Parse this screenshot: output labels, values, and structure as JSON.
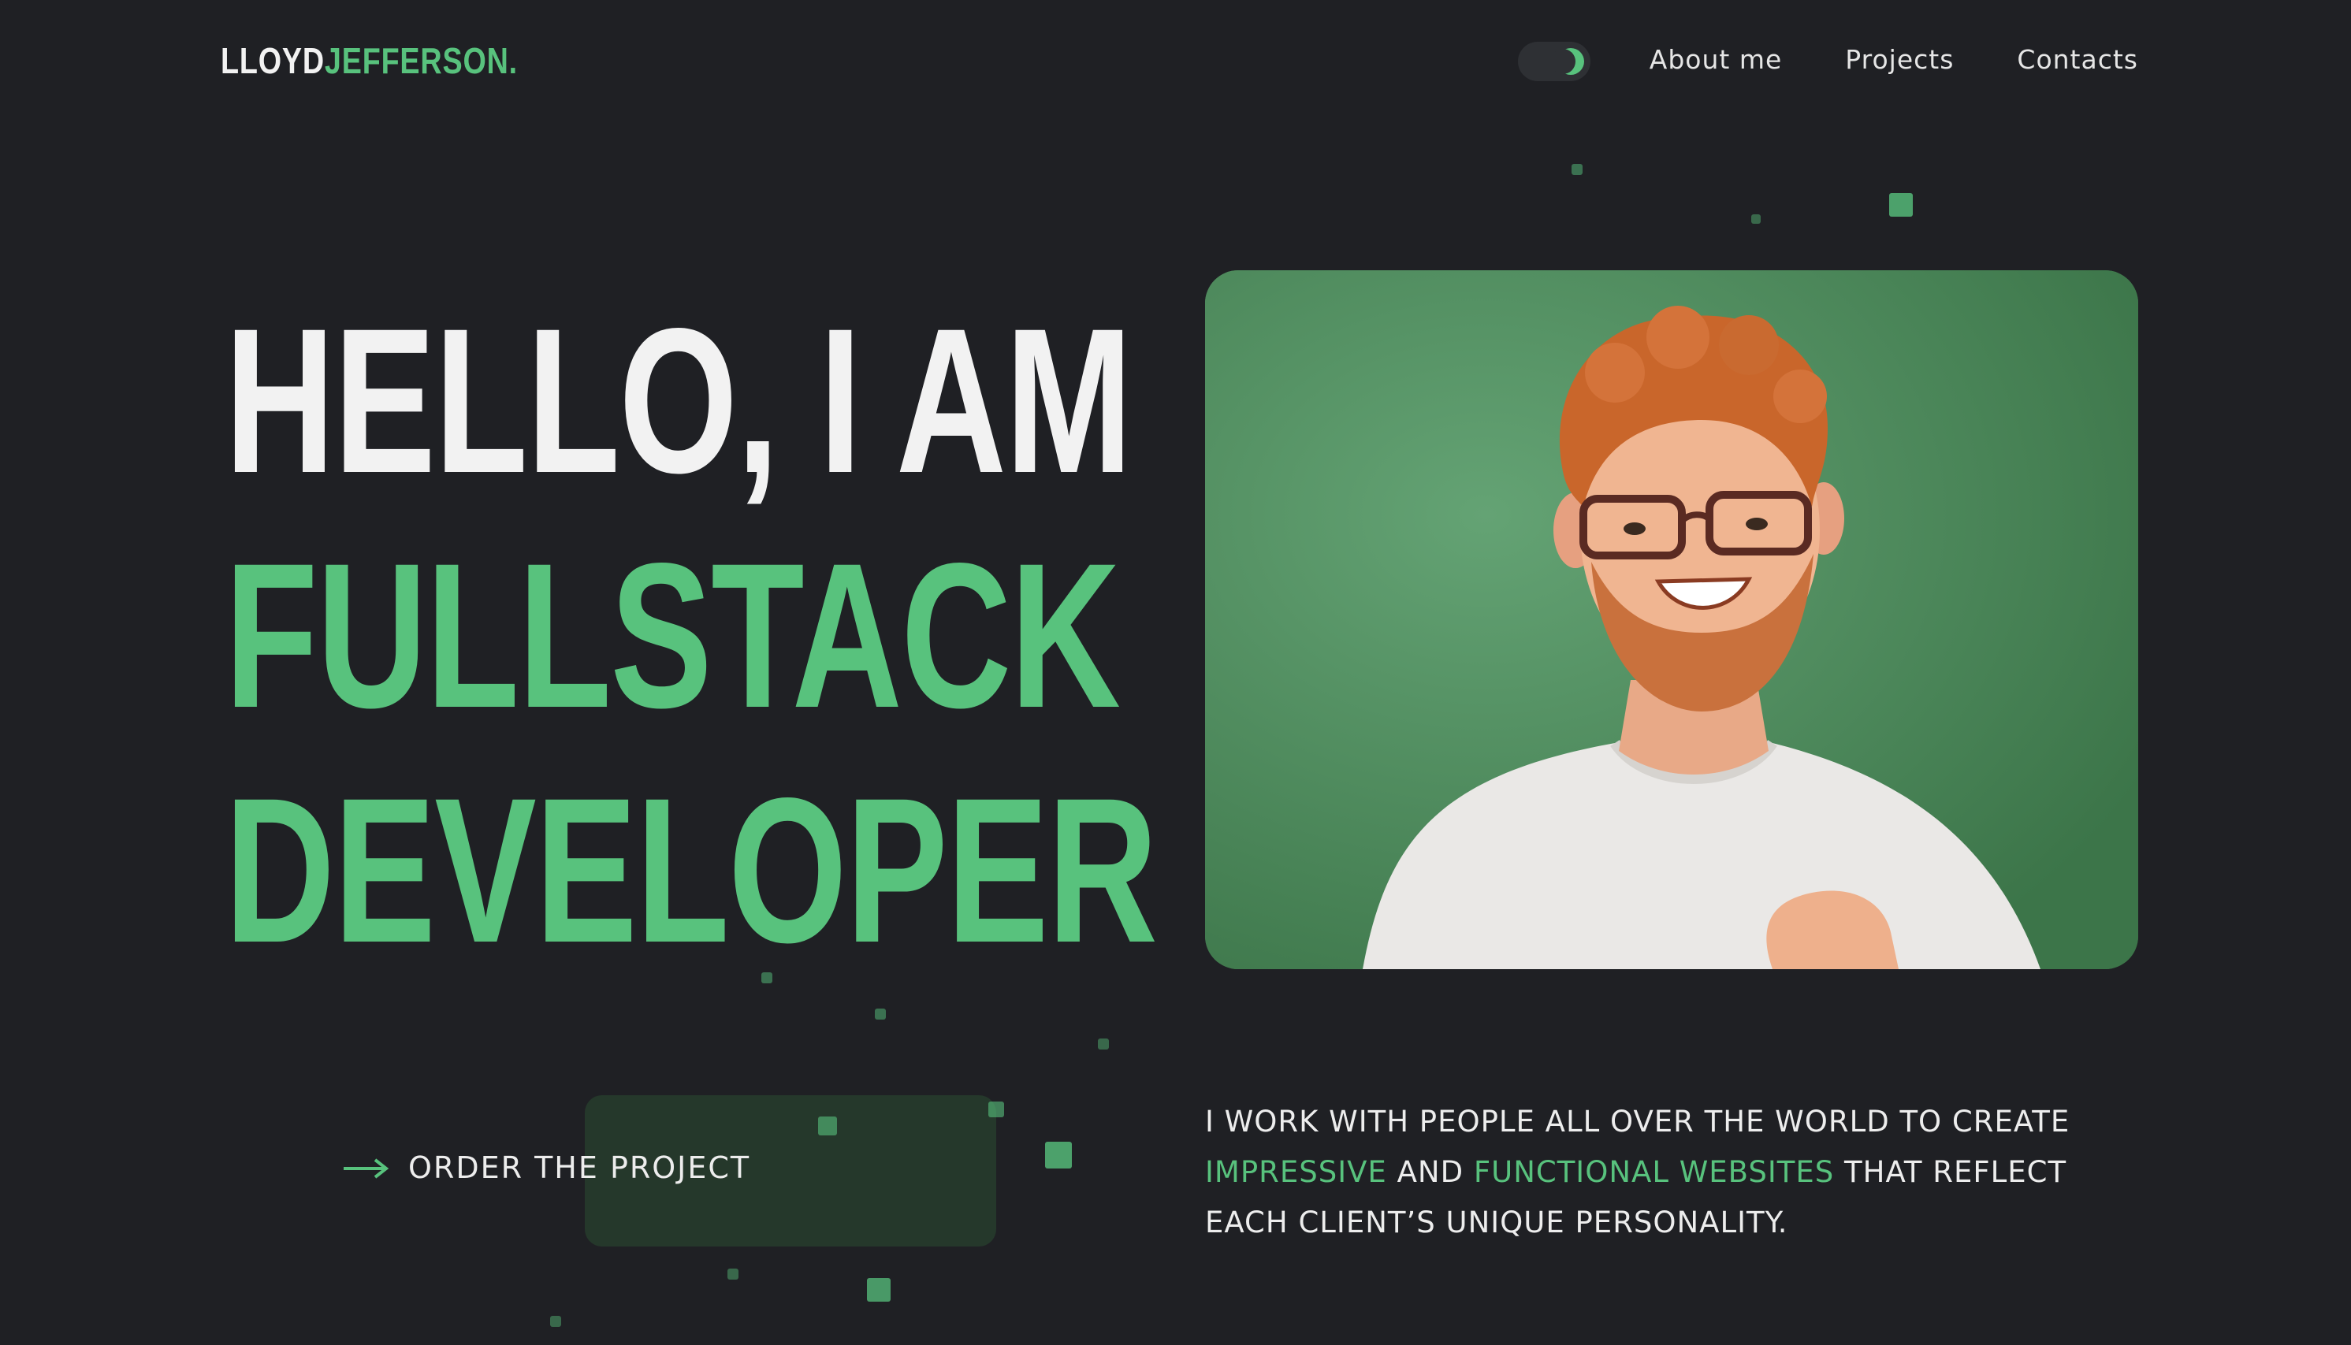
{
  "header": {
    "logo": {
      "part1": "LLOYD",
      "part2": "JEFFERSON",
      "part3": "."
    },
    "theme_toggle_icon": "moon-icon",
    "nav": [
      {
        "label": "About me"
      },
      {
        "label": "Projects"
      },
      {
        "label": "Contacts"
      }
    ]
  },
  "hero": {
    "line1": "HELLO, I AM",
    "line2": "FULLSTACK",
    "line3": "DEVELOPER",
    "photo_icon": "portrait-photo"
  },
  "cta": {
    "label": "ORDER THE PROJECT",
    "icon": "arrow-right-icon"
  },
  "tagline": {
    "t1": "I work with people all over the world to create ",
    "hl1": "impressive",
    "t2": " and ",
    "hl2": "functional websites",
    "t3": " that reflect each client’s unique personality."
  },
  "colors": {
    "accent": "#58c27d",
    "background": "#1f2024",
    "cta_bg": "#25382b"
  }
}
